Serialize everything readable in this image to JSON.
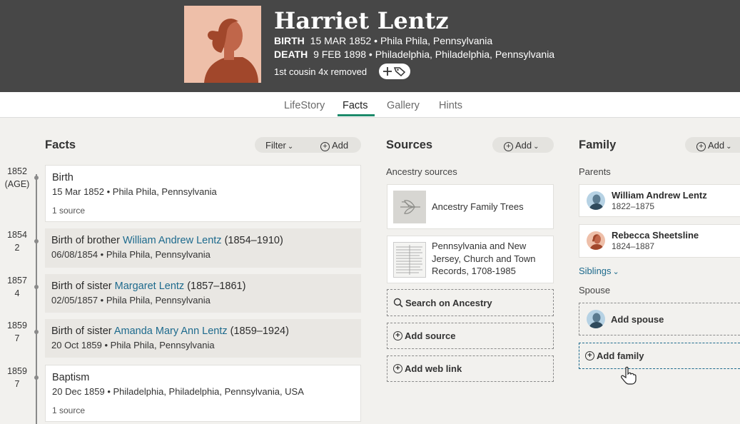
{
  "person": {
    "name": "Harriet Lentz",
    "birth_label": "BIRTH",
    "birth_value": "15 MAR 1852 • Phila Phila, Pennsylvania",
    "death_label": "DEATH",
    "death_value": "9 FEB 1898 • Philadelphia, Philadelphia, Pennsylvania",
    "relationship": "1st cousin 4x removed"
  },
  "tabs": [
    "LifeStory",
    "Facts",
    "Gallery",
    "Hints"
  ],
  "facts": {
    "title": "Facts",
    "filter_label": "Filter",
    "add_label": "Add",
    "items": [
      {
        "year": "1852",
        "age": "(AGE)",
        "title": "Birth",
        "date": "15 Mar 1852 • Phila Phila, Pennsylvania",
        "sources": "1 source"
      },
      {
        "year": "1854",
        "age": "2",
        "prefix": "Birth of brother ",
        "link": "William Andrew Lentz",
        "suffix": " (1854–1910)",
        "date": "06/08/1854 • Phila Phila, Pennsylvania"
      },
      {
        "year": "1857",
        "age": "4",
        "prefix": "Birth of sister ",
        "link": "Margaret Lentz",
        "suffix": " (1857–1861)",
        "date": "02/05/1857 • Phila Phila, Pennsylvania"
      },
      {
        "year": "1859",
        "age": "7",
        "prefix": "Birth of sister ",
        "link": "Amanda Mary Ann Lentz",
        "suffix": " (1859–1924)",
        "date": "20 Oct 1859 • Phila Phila, Pennsylvania"
      },
      {
        "year": "1859",
        "age": "7",
        "title": "Baptism",
        "date": "20 Dec 1859 • Philadelphia, Philadelphia, Pennsylvania, USA",
        "sources": "1 source"
      }
    ]
  },
  "sources": {
    "title": "Sources",
    "add_label": "Add",
    "subtitle": "Ancestry sources",
    "items": [
      {
        "label": "Ancestry Family Trees",
        "icon": "leaf-icon"
      },
      {
        "label": "Pennsylvania and New Jersey, Church and Town Records, 1708-1985",
        "icon": "document-thumbnail"
      }
    ],
    "search_label": "Search on Ancestry",
    "add_source_label": "Add source",
    "add_web_link_label": "Add web link"
  },
  "family": {
    "title": "Family",
    "add_label": "Add",
    "parents_label": "Parents",
    "parents": [
      {
        "name": "William Andrew Lentz",
        "years": "1822–1875",
        "gender_color": "#b6d2e4"
      },
      {
        "name": "Rebecca Sheetsline",
        "years": "1824–1887",
        "gender_color": "#eebfa9"
      }
    ],
    "siblings_label": "Siblings",
    "spouse_label": "Spouse",
    "add_spouse_label": "Add spouse",
    "add_family_label": "Add family"
  },
  "colors": {
    "header_bg": "#474747",
    "link": "#1d6a8d",
    "active_tab": "#1c8a6a"
  }
}
